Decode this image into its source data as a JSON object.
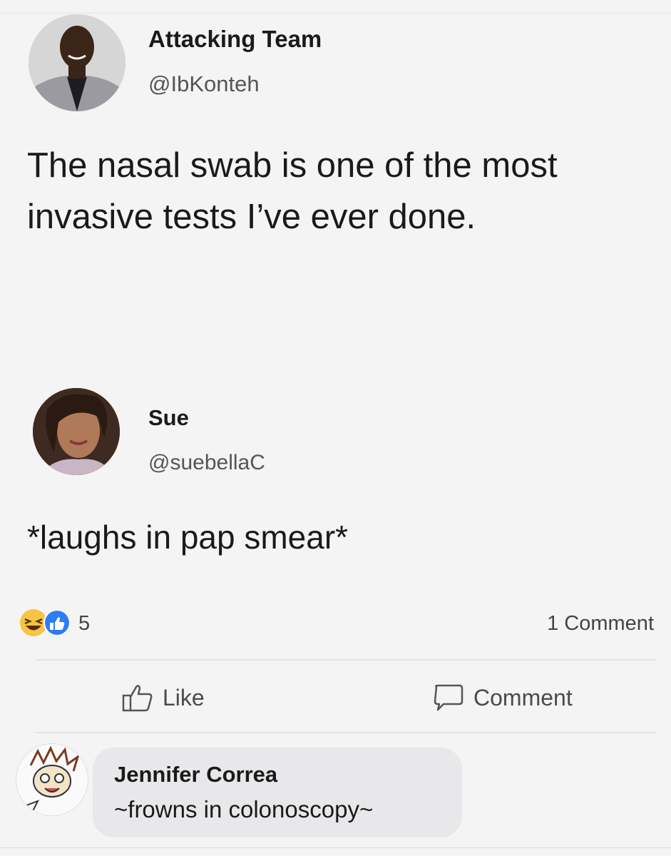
{
  "posts": [
    {
      "author_name": "Attacking Team",
      "handle": "@IbKonteh",
      "text": "The nasal swab is one of the most invasive tests I’ve ever done.",
      "avatar_icon": "man-in-suit-avatar"
    },
    {
      "author_name": "Sue",
      "handle": "@suebellaC",
      "text": "*laughs in pap smear*",
      "avatar_icon": "woman-portrait-avatar"
    }
  ],
  "reactions": {
    "icons": [
      "laughing-emoji-icon",
      "thumbs-up-icon"
    ],
    "count": "5",
    "comment_count_label": "1 Comment"
  },
  "actions": {
    "like_label": "Like",
    "comment_label": "Comment"
  },
  "comment": {
    "author": "Jennifer Correa",
    "text": "~frowns in colonoscopy~",
    "avatar_icon": "cartoon-character-avatar"
  },
  "colors": {
    "background": "#f4f4f4",
    "like_blue": "#2d7cf6",
    "haha_yellow": "#f7c443",
    "comment_bubble": "#e8e8ea"
  }
}
